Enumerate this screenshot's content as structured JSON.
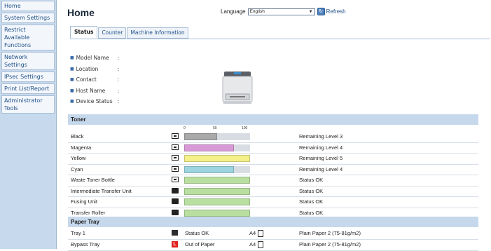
{
  "sidebar": {
    "items": [
      {
        "label": "Home"
      },
      {
        "label": "System Settings"
      },
      {
        "label": "Restrict Available Functions"
      },
      {
        "label": "Network Settings"
      },
      {
        "label": "IPsec Settings"
      },
      {
        "label": "Print List/Report"
      },
      {
        "label": "Administrator Tools"
      }
    ]
  },
  "header": {
    "title": "Home",
    "language_label": "Language",
    "language_value": "English",
    "refresh_label": "Refresh"
  },
  "tabs": [
    {
      "label": "Status",
      "active": true
    },
    {
      "label": "Counter",
      "active": false
    },
    {
      "label": "Machine Information",
      "active": false
    }
  ],
  "info": [
    {
      "label": "Model Name",
      "sep": ":"
    },
    {
      "label": "Location",
      "sep": ":"
    },
    {
      "label": "Contact",
      "sep": ":"
    },
    {
      "label": "Host Name",
      "sep": ":"
    },
    {
      "label": "Device Status",
      "sep": ":"
    }
  ],
  "toner": {
    "heading": "Toner",
    "scale": [
      "0",
      "50",
      "100"
    ],
    "rows": [
      {
        "name": "Black",
        "level": 0.5,
        "color": "#a9a9a9",
        "status": "Remaining Level 3",
        "icon": "toner-icon"
      },
      {
        "name": "Magenta",
        "level": 0.75,
        "color": "#d79ad6",
        "status": "Remaining Level 4",
        "icon": "toner-icon"
      },
      {
        "name": "Yellow",
        "level": 1.0,
        "color": "#f4f08a",
        "status": "Remaining Level 5",
        "icon": "toner-icon"
      },
      {
        "name": "Cyan",
        "level": 0.75,
        "color": "#9cd5df",
        "status": "Remaining Level 4",
        "icon": "toner-icon"
      },
      {
        "name": "Waste Toner Bottle",
        "level": 1.0,
        "color": "#b9dfa0",
        "status": "Status OK",
        "icon": "waste-bottle-icon"
      },
      {
        "name": "Intermediate Transfer Unit",
        "level": 1.0,
        "color": "#b9dfa0",
        "status": "Status OK",
        "icon": "unit-icon"
      },
      {
        "name": "Fusing Unit",
        "level": 1.0,
        "color": "#b9dfa0",
        "status": "Status OK",
        "icon": "unit-icon"
      },
      {
        "name": "Transfer Roller",
        "level": 1.0,
        "color": "#b9dfa0",
        "status": "Status OK",
        "icon": "unit-icon"
      }
    ]
  },
  "paper": {
    "heading": "Paper Tray",
    "rows": [
      {
        "name": "Tray 1",
        "status": "Status OK",
        "size": "A4",
        "type": "Plain Paper 2 (75-81g/m2)",
        "icon": "tray-ok-icon"
      },
      {
        "name": "Bypass Tray",
        "status": "Out of Paper",
        "size": "A4",
        "type": "Plain Paper 2 (75-81g/m2)",
        "icon": "tray-error-icon",
        "icon_text": "L"
      }
    ]
  }
}
